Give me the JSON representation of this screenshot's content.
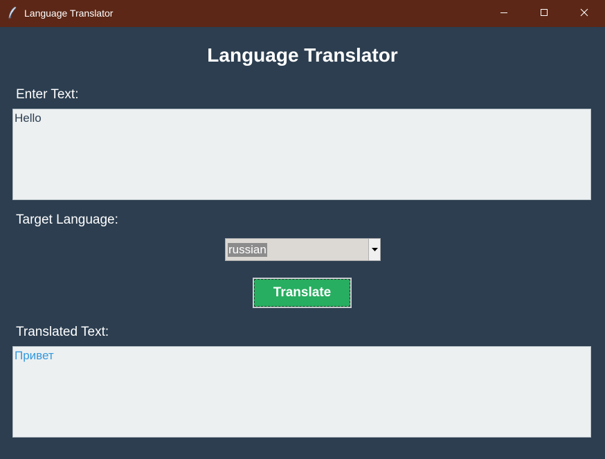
{
  "window": {
    "title": "Language Translator",
    "titlebar_color": "#5c2716",
    "background_color": "#2c3e50"
  },
  "icons": {
    "app": "feather-icon",
    "minimize": "minimize-icon",
    "maximize": "maximize-icon",
    "close": "close-icon",
    "dropdown": "chevron-down-icon"
  },
  "header": {
    "title": "Language Translator"
  },
  "input": {
    "label": "Enter Text:",
    "value": "Hello"
  },
  "target_language": {
    "label": "Target Language:",
    "selected": "russian"
  },
  "translate_button": {
    "label": "Translate",
    "color": "#27ae60"
  },
  "output": {
    "label": "Translated Text:",
    "value": "Привет",
    "text_color": "#3498db"
  }
}
